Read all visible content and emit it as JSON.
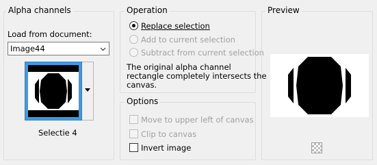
{
  "alpha": {
    "title": "Alpha channels",
    "load_label": "Load from document:",
    "document_value": "Image44",
    "thumbnail_caption": "Selectie 4"
  },
  "operation": {
    "title": "Operation",
    "options": [
      {
        "label": "Replace selection",
        "selected": true,
        "enabled": true
      },
      {
        "label": "Add to current selection",
        "selected": false,
        "enabled": false
      },
      {
        "label": "Subtract from current selection",
        "selected": false,
        "enabled": false
      }
    ],
    "message_line1": "The original alpha channel",
    "message_line2": "rectangle completely intersects the",
    "message_line3": "canvas."
  },
  "options": {
    "title": "Options",
    "checks": [
      {
        "label": "Move to upper left of canvas",
        "checked": false,
        "enabled": false
      },
      {
        "label": "Clip to canvas",
        "checked": false,
        "enabled": false
      },
      {
        "label": "Invert image",
        "checked": false,
        "enabled": true
      }
    ]
  },
  "preview": {
    "title": "Preview",
    "background_toggle_icon": "checkerboard-icon"
  },
  "colors": {
    "selection_blue": "#3c9be6",
    "disabled_text": "#a0a0a0",
    "panel_bg": "#f0f0f0"
  }
}
